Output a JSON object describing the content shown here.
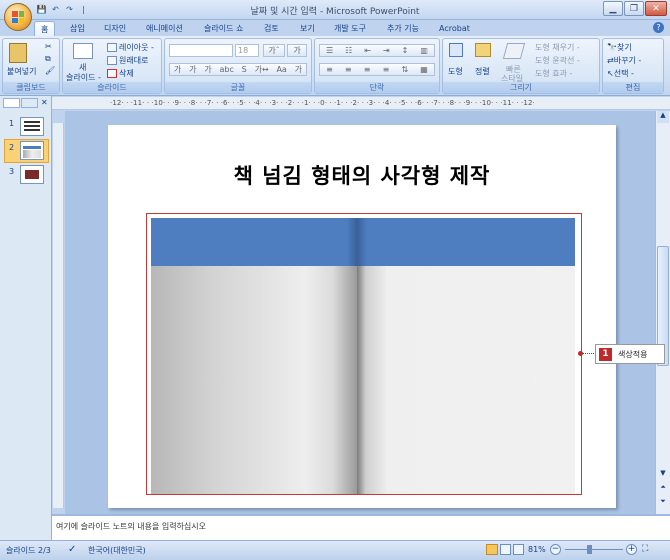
{
  "app": {
    "title": "날짜 및 시간 입력 - Microsoft PowerPoint"
  },
  "qat": {
    "undo": "↶",
    "redo": "↷",
    "sep": "|"
  },
  "tabs": [
    {
      "label": "홈"
    },
    {
      "label": "삽입"
    },
    {
      "label": "디자인"
    },
    {
      "label": "애니메이션"
    },
    {
      "label": "슬라이드 쇼"
    },
    {
      "label": "검토"
    },
    {
      "label": "보기"
    },
    {
      "label": "개발 도구"
    },
    {
      "label": "추가 기능"
    },
    {
      "label": "Acrobat"
    }
  ],
  "ribbon": {
    "clipboard": {
      "label": "클립보드",
      "paste": "붙여넣기"
    },
    "slides": {
      "label": "슬라이드",
      "new_slide_1": "새",
      "new_slide_2": "슬라이드 -",
      "layout": "레이아웃 -",
      "reset": "원래대로",
      "delete": "삭제"
    },
    "font": {
      "label": "글꼴",
      "size": "18"
    },
    "paragraph": {
      "label": "단락"
    },
    "drawing": {
      "label": "그리기",
      "shapes": "도형",
      "arrange": "정렬",
      "quick_styles_1": "빠른",
      "quick_styles_2": "스타일",
      "fill": "도형 채우기 -",
      "outline": "도형 윤곽선 -",
      "effects": "도형 효과 -"
    },
    "editing": {
      "label": "편집",
      "find": "찾기",
      "replace": "바꾸기 -",
      "select": "선택 -"
    }
  },
  "ruler": {
    "horizontal": "·12· · ·11· · ·10· · ·9· · ·8· · ·7· · ·6· · ·5· · ·4· · ·3· · ·2· · ·1· · ·0· · ·1· · ·2· · ·3· · ·4· · ·5· · ·6· · ·7· · ·8· · ·9· · ·10· · ·11· · ·12·"
  },
  "thumbnails": [
    {
      "num": "1"
    },
    {
      "num": "2"
    },
    {
      "num": "3"
    }
  ],
  "slide": {
    "title": "책 넘김 형태의 사각형 제작"
  },
  "callout": {
    "num": "1",
    "text": "색상적용"
  },
  "notes": {
    "placeholder": "여기에 슬라이드 노트의 내용을 입력하십시오"
  },
  "status": {
    "slide": "슬라이드 2/3",
    "language": "한국어(대한민국)",
    "zoom": "81%"
  },
  "colors": {
    "header_blue": "#4e7ec0",
    "border_red": "#c43a3a",
    "callout_red": "#c0292c"
  }
}
